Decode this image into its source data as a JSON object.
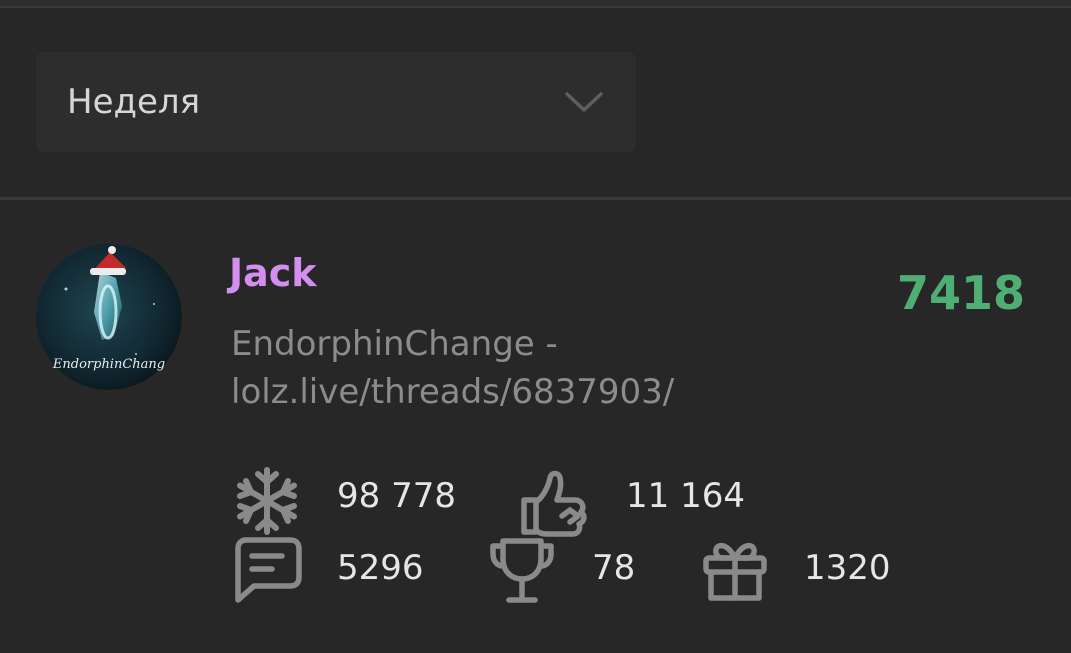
{
  "filter": {
    "selected": "Неделя"
  },
  "entry": {
    "username": "Jack",
    "score": "7418",
    "status_line1": "EndorphinChange -",
    "status_line2": "lolz.live/threads/6837903/",
    "avatar_text": "EndorphinChang",
    "stats": {
      "snowflakes": "98 778",
      "likes": "11 164",
      "messages": "5296",
      "trophies": "78",
      "gifts": "1320"
    }
  },
  "colors": {
    "background": "#272727",
    "username": "#d38ef0",
    "score": "#4eae74",
    "status": "#8c8c8c",
    "stat_value": "#e6e6e6",
    "icon": "#8a8a8a"
  },
  "icons": {
    "dropdown": "chevron-down-icon",
    "snowflakes": "snowflake-icon",
    "likes": "thumbs-up-icon",
    "messages": "message-icon",
    "trophies": "trophy-icon",
    "gifts": "gift-icon"
  }
}
